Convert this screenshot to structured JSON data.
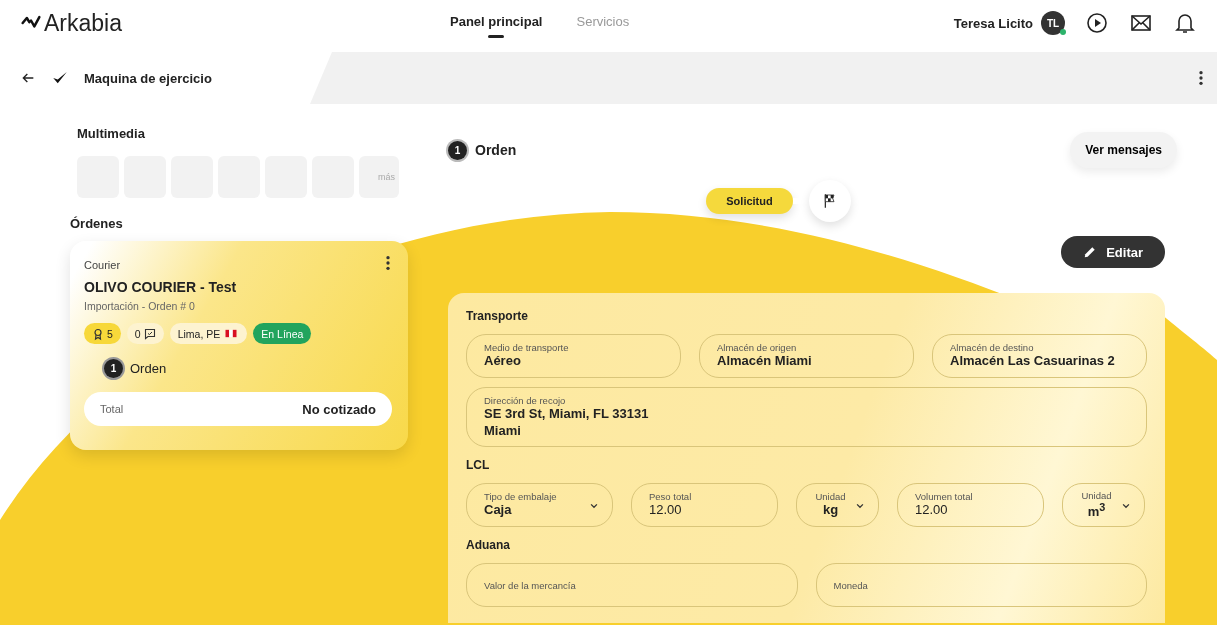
{
  "header": {
    "logo": "Arkabia",
    "nav": [
      {
        "label": "Panel principal",
        "selected": true
      },
      {
        "label": "Servicios",
        "selected": false
      }
    ],
    "user": {
      "name": "Teresa Licito",
      "initials": "TL",
      "online": true
    }
  },
  "subbar": {
    "title": "Maquina de ejercicio"
  },
  "multimedia": {
    "title": "Multimedia",
    "tiles": [
      {
        "kind": "empty"
      },
      {
        "kind": "empty"
      },
      {
        "kind": "empty"
      },
      {
        "kind": "empty"
      },
      {
        "kind": "empty"
      },
      {
        "kind": "empty"
      },
      {
        "kind": "more",
        "label": "más"
      }
    ]
  },
  "orders": {
    "title": "Órdenes",
    "card": {
      "type": "Courier",
      "name": "OLIVO COURIER - Test",
      "subtitle": "Importación - Orden # 0",
      "badges": [
        {
          "kind": "rating",
          "label": "5"
        },
        {
          "kind": "messages",
          "label": "0"
        },
        {
          "kind": "location",
          "label": "Lima, PE"
        },
        {
          "kind": "status",
          "label": "En Línea"
        }
      ],
      "order_number": "1",
      "order_label": "Orden",
      "total_label": "Total",
      "total_value": "No cotizado"
    }
  },
  "order": {
    "number": "1",
    "title": "Orden",
    "messages_button": "Ver mensajes",
    "steps": [
      {
        "kind": "label",
        "label": "Solicitud",
        "selected": true
      },
      {
        "kind": "flag",
        "selected": false
      }
    ],
    "edit_button": "Editar",
    "sections": [
      {
        "title": "Transporte",
        "rows": [
          [
            {
              "kind": "text",
              "label": "Medio de transporte",
              "value": "Aéreo"
            },
            {
              "kind": "text",
              "label": "Almacén de origen",
              "value": "Almacén Miami"
            },
            {
              "kind": "text",
              "label": "Almacén de destino",
              "value": "Almacén Las Casuarinas 2"
            }
          ],
          [
            {
              "kind": "area",
              "label": "Dirección de recojo",
              "value": "SE 3rd St, Miami, FL 33131\nMiami"
            }
          ]
        ]
      },
      {
        "title": "LCL",
        "rows": [
          [
            {
              "kind": "select",
              "label": "Tipo de embalaje",
              "value": "Caja"
            },
            {
              "kind": "text",
              "label": "Peso total",
              "value": "12.00"
            },
            {
              "kind": "unit",
              "label": "Unidad",
              "value": "kg"
            },
            {
              "kind": "text",
              "label": "Volumen total",
              "value": "12.00"
            },
            {
              "kind": "unit",
              "label": "Unidad",
              "value": "m$^{3}$"
            }
          ]
        ]
      },
      {
        "title": "Aduana",
        "rows": [
          [
            {
              "kind": "text",
              "label": "Valor de la mercancía"
            },
            {
              "kind": "text",
              "label": "Moneda"
            }
          ]
        ]
      }
    ]
  }
}
